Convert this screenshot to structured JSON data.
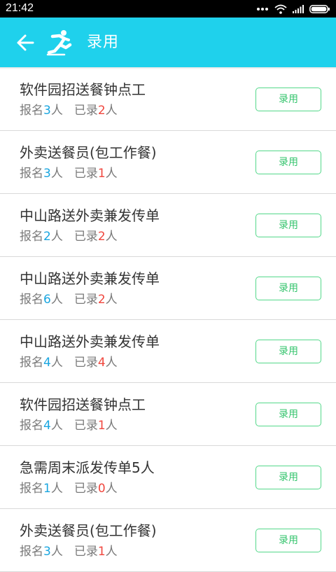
{
  "status_bar": {
    "time": "21:42"
  },
  "app_bar": {
    "title": "录用",
    "back_icon": "arrow-left-icon",
    "logo_icon": "running-person-icon",
    "background": "#1fd1ec"
  },
  "colors": {
    "signup_count": "#1aa6e0",
    "hired_count": "#f0473e",
    "button_border": "#54d88a",
    "button_text": "#35c46d"
  },
  "items": [
    {
      "title": "软件园招送餐钟点工",
      "signup_label": "报名",
      "signup_count": "3",
      "unit1": "人",
      "hired_label": "已录",
      "hired_count": "2",
      "unit2": "人",
      "button": "录用"
    },
    {
      "title": "外卖送餐员(包工作餐)",
      "signup_label": "报名",
      "signup_count": "3",
      "unit1": "人",
      "hired_label": "已录",
      "hired_count": "1",
      "unit2": "人",
      "button": "录用"
    },
    {
      "title": "中山路送外卖兼发传单",
      "signup_label": "报名",
      "signup_count": "2",
      "unit1": "人",
      "hired_label": "已录",
      "hired_count": "2",
      "unit2": "人",
      "button": "录用"
    },
    {
      "title": "中山路送外卖兼发传单",
      "signup_label": "报名",
      "signup_count": "6",
      "unit1": "人",
      "hired_label": "已录",
      "hired_count": "2",
      "unit2": "人",
      "button": "录用"
    },
    {
      "title": "中山路送外卖兼发传单",
      "signup_label": "报名",
      "signup_count": "4",
      "unit1": "人",
      "hired_label": "已录",
      "hired_count": "4",
      "unit2": "人",
      "button": "录用"
    },
    {
      "title": "软件园招送餐钟点工",
      "signup_label": "报名",
      "signup_count": "4",
      "unit1": "人",
      "hired_label": "已录",
      "hired_count": "1",
      "unit2": "人",
      "button": "录用"
    },
    {
      "title": "急需周末派发传单5人",
      "signup_label": "报名",
      "signup_count": "1",
      "unit1": "人",
      "hired_label": "已录",
      "hired_count": "0",
      "unit2": "人",
      "button": "录用"
    },
    {
      "title": "外卖送餐员(包工作餐)",
      "signup_label": "报名",
      "signup_count": "3",
      "unit1": "人",
      "hired_label": "已录",
      "hired_count": "1",
      "unit2": "人",
      "button": "录用"
    }
  ]
}
